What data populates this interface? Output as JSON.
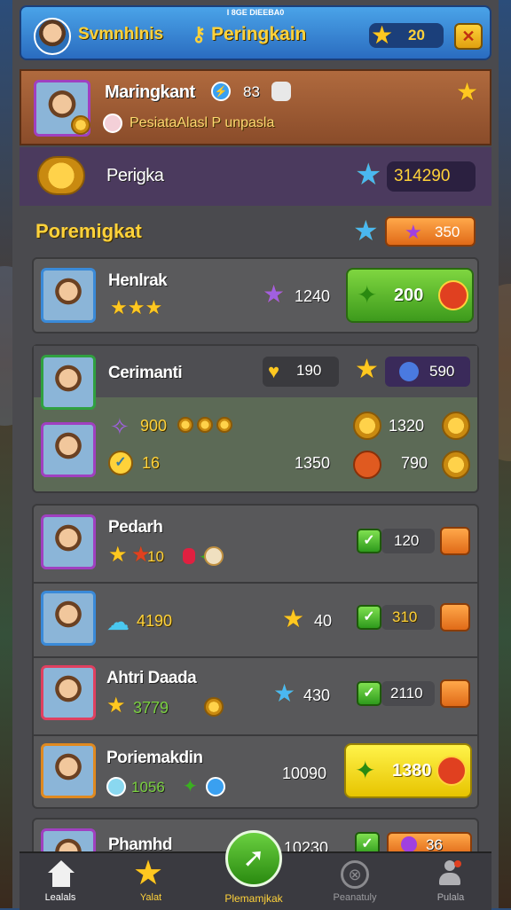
{
  "header": {
    "tiny_label": "I 8GE DIEEBA0",
    "player_name": "Svmnhlnis",
    "title": "Peringkain",
    "star_count": "20"
  },
  "profile": {
    "name": "Maringkant",
    "level": "83",
    "subtitle": "PesiataAlasl P unpasla"
  },
  "summary": {
    "label": "Perigka",
    "value": "314290"
  },
  "section": {
    "title": "Poremigkat",
    "value": "350"
  },
  "rows": [
    {
      "name": "Henlrak",
      "value": "1240",
      "button_label": "200"
    },
    {
      "name": "Cerimanti",
      "heart_value": "190",
      "value": "590",
      "sub": [
        {
          "left": "900",
          "right_value": "1320"
        },
        {
          "left": "16",
          "mid_value": "1350",
          "right_value": "790"
        }
      ]
    },
    {
      "name": "Pedarh",
      "inline": "10",
      "value": "120"
    },
    {
      "name": "",
      "left": "4190",
      "star_value": "40",
      "value": "310"
    },
    {
      "name": "Ahtri Daada",
      "left": "3779",
      "star_value": "430",
      "value": "2110"
    },
    {
      "name": "Poriemakdin",
      "left": "1056",
      "mid_value": "10090",
      "button_label": "1380"
    },
    {
      "name": "Phamhd",
      "value": "10230",
      "right_value": "36"
    }
  ],
  "nav": [
    {
      "label": "Lealals",
      "icon": "home-icon"
    },
    {
      "label": "Yalat",
      "icon": "star-icon"
    },
    {
      "label": "Plemamjkak",
      "icon": "leaf-icon"
    },
    {
      "label": "Peanatuly",
      "icon": "badge-icon"
    },
    {
      "label": "Pulala",
      "icon": "profile-icon"
    }
  ],
  "colors": {
    "accent_blue": "#2a6cc0",
    "gold": "#ffc820",
    "green_button": "#4ab82a",
    "yellow_button": "#f0d000",
    "orange": "#e8801c",
    "panel": "#4a4a4e"
  }
}
